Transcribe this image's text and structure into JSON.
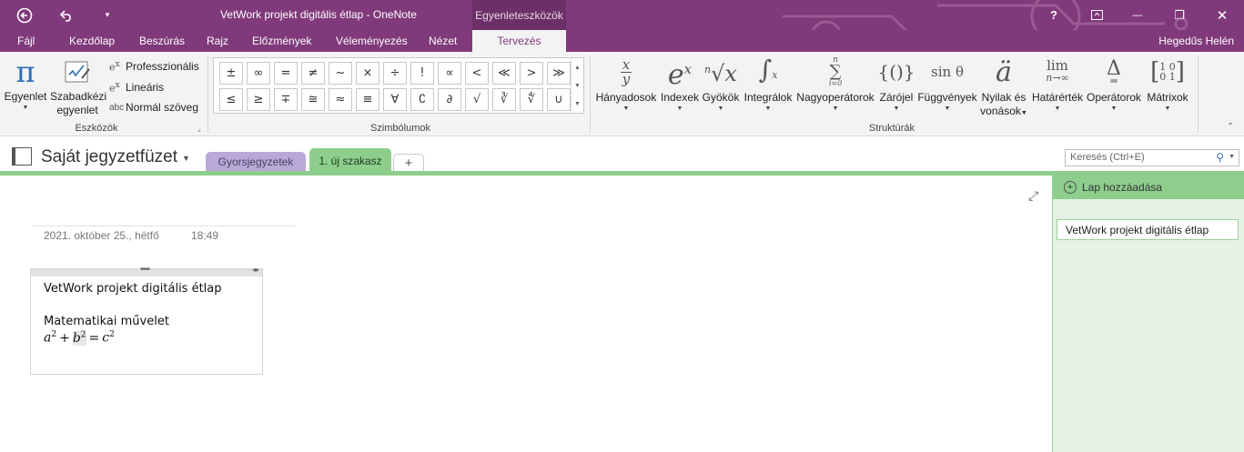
{
  "window": {
    "title": "VetWork projekt digitális étlap - OneNote",
    "context_tab": "Egyenleteszközök",
    "buttons": {
      "back_icon": "back-circle-icon",
      "undo_icon": "undo-icon",
      "help": "?",
      "minimize": "—",
      "restore": "❐",
      "close": "✕"
    }
  },
  "menu": {
    "tabs": [
      {
        "label": "Fájl"
      },
      {
        "label": "Kezdőlap"
      },
      {
        "label": "Beszúrás"
      },
      {
        "label": "Rajz"
      },
      {
        "label": "Előzmények"
      },
      {
        "label": "Véleményezés"
      },
      {
        "label": "Nézet"
      },
      {
        "label": "Tervezés",
        "active": true
      }
    ],
    "user": "Hegedűs Helén"
  },
  "ribbon": {
    "tools": {
      "label": "Eszközök",
      "equation": {
        "label": "Egyenlet",
        "glyph": "π"
      },
      "ink": {
        "label_line1": "Szabadkézi",
        "label_line2": "egyenlet"
      },
      "professional": "Professzionális",
      "linear": "Lineáris",
      "normal_text": "Normál szöveg",
      "normal_text_icon": "abc"
    },
    "symbols": {
      "label": "Szimbólumok",
      "row1": [
        "±",
        "∞",
        "=",
        "≠",
        "~",
        "×",
        "÷",
        "!",
        "∝",
        "<",
        "≪",
        ">",
        "≫"
      ],
      "row2": [
        "≤",
        "≥",
        "∓",
        "≅",
        "≈",
        "≡",
        "∀",
        "∁",
        "∂",
        "√",
        "∛",
        "∜",
        "∪"
      ]
    },
    "structures": {
      "label": "Struktúrák",
      "items": [
        {
          "label": "Hányadosok",
          "glyph": "x/y"
        },
        {
          "label": "Indexek",
          "glyph": "eˣ"
        },
        {
          "label": "Gyökök",
          "glyph": "ⁿ√x"
        },
        {
          "label": "Integrálok",
          "glyph": "∫"
        },
        {
          "label": "Nagyoperátorok",
          "glyph": "∑"
        },
        {
          "label": "Zárójel",
          "glyph": "{()}"
        },
        {
          "label": "Függvények",
          "glyph": "sin θ"
        },
        {
          "label_line1": "Nyilak és",
          "label_line2": "vonások",
          "glyph": "ä"
        },
        {
          "label": "Határérték",
          "glyph": "lim"
        },
        {
          "label": "Operátorok",
          "glyph": "Δ"
        },
        {
          "label": "Mátrixok",
          "glyph": "[10 01]"
        }
      ]
    }
  },
  "notebook": {
    "name": "Saját jegyzetfüzet",
    "sections": [
      {
        "label": "Gyorsjegyzetek",
        "color": "#b9a9d8"
      },
      {
        "label": "1. új szakasz",
        "color": "#8dce8d",
        "active": true
      },
      {
        "label": "+"
      }
    ],
    "search_placeholder": "Keresés (Ctrl+E)"
  },
  "page": {
    "date": "2021. október 25., hétfő",
    "time": "18:49",
    "note": {
      "title": "VetWork projekt digitális étlap",
      "heading": "Matematikai művelet",
      "equation": {
        "a": "a",
        "b": "b",
        "c": "c",
        "exp": "2",
        "plus": "+",
        "equals": "="
      }
    }
  },
  "pages_pane": {
    "add_page": "Lap hozzáadása",
    "pages": [
      "VetWork projekt digitális étlap"
    ]
  },
  "colors": {
    "accent": "#80397b",
    "section_green": "#8dce8d",
    "pane_green": "#e5f2e5"
  }
}
